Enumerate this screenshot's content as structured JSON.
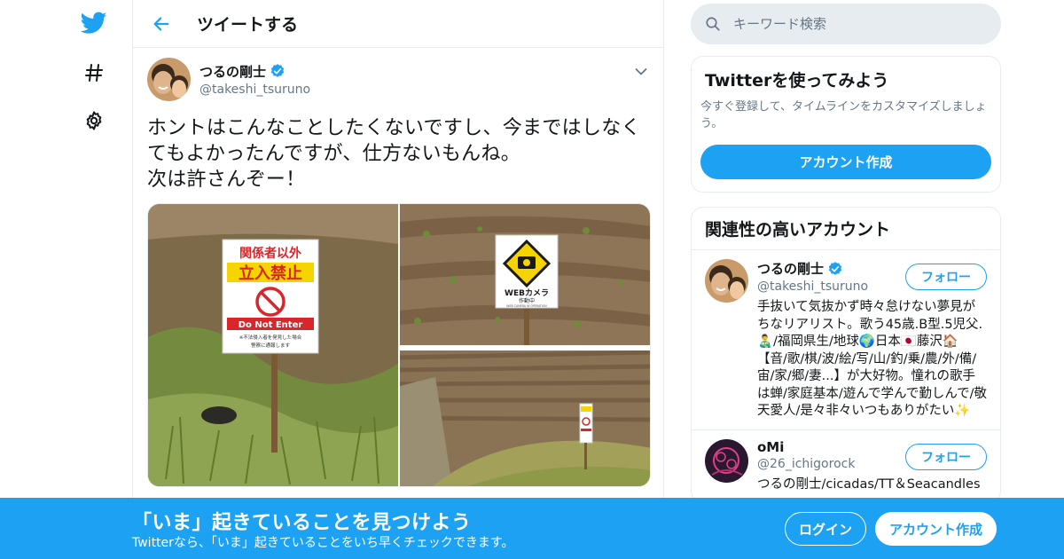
{
  "colors": {
    "brand": "#1da1f2",
    "text": "#14171a",
    "secondary": "#657786",
    "border": "#e6ecf0"
  },
  "nav": {
    "icons": [
      "twitter-logo-icon",
      "hashtag-icon",
      "gear-icon"
    ]
  },
  "header": {
    "title": "ツイートする"
  },
  "tweet": {
    "author_name": "つるの剛士",
    "author_handle": "@takeshi_tsuruno",
    "verified": true,
    "text": "ホントはこんなことしたくないですし、今まではしなくてもよかったんですが、仕方ないもんね。\n次は許さんぞー！",
    "photos": [
      {
        "sign_top_line": "関係者以外",
        "sign_main_line": "立入禁止",
        "sign_english": "Do Not Enter",
        "sign_note_1": "※不法侵入者を発見した場合",
        "sign_note_2": "警察に通報します"
      },
      {
        "sign_line_1": "WEBカメラ",
        "sign_line_2": "作動中",
        "sign_line_3": "WEB CAMERA IN OPERATION"
      },
      {}
    ]
  },
  "search": {
    "placeholder": "キーワード検索"
  },
  "signup_card": {
    "title": "Twitterを使ってみよう",
    "description": "今すぐ登録して、タイムラインをカスタマイズしましょう。",
    "button": "アカウント作成"
  },
  "related": {
    "title": "関連性の高いアカウント",
    "accounts": [
      {
        "name": "つるの剛士",
        "handle": "@takeshi_tsuruno",
        "verified": true,
        "follow_label": "フォロー",
        "bio": "手抜いて気抜かず時々怠けない夢見がちなリアリスト。歌う45歳.B型.5児父.👨‍🍼/福岡県生/地球🌍日本🇯🇵藤沢🏠【音/歌/棋/波/絵/写/山/釣/乗/農/外/備/宙/家/郷/妻...】が大好物。憧れの歌手は蝉/家庭基本/遊んで学んで勤しんで/敬天愛人/是々非々いつもありがたい✨"
      },
      {
        "name": "oMi",
        "handle": "@26_ichigorock",
        "verified": false,
        "follow_label": "フォロー",
        "bio": "つるの剛士/cicadas/TT＆Seacandles"
      }
    ]
  },
  "banner": {
    "title": "「いま」起きていることを見つけよう",
    "subtitle": "Twitterなら、「いま」起きていることをいち早くチェックできます。",
    "login": "ログイン",
    "signup": "アカウント作成"
  }
}
